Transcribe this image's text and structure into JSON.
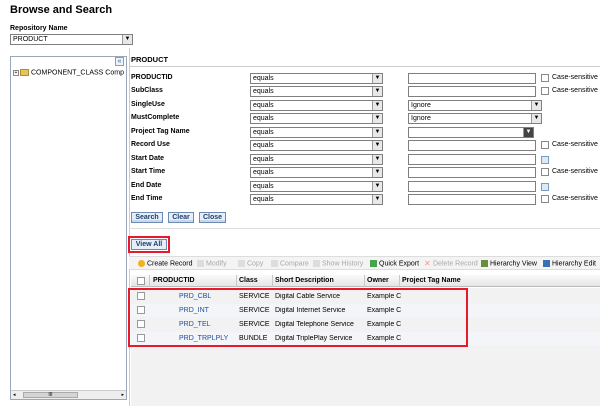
{
  "page": {
    "title": "Browse and Search"
  },
  "repository": {
    "label": "Repository Name",
    "value": "PRODUCT"
  },
  "tree": {
    "collapse_glyph": "«",
    "items": [
      "COMPONENT_CLASS Comp"
    ],
    "scroll_glyph": "III"
  },
  "search": {
    "section_title": "PRODUCT",
    "criteria": [
      {
        "label": "PRODUCTID",
        "operator": "equals",
        "value": "",
        "case_sensitive_label": "Case-sensitive",
        "has_case": true
      },
      {
        "label": "SubClass",
        "operator": "equals",
        "value": "",
        "case_sensitive_label": "Case-sensitive",
        "has_case": true
      },
      {
        "label": "SingleUse",
        "operator": "equals",
        "value": "Ignore",
        "has_case": false
      },
      {
        "label": "MustComplete",
        "operator": "equals",
        "value": "Ignore",
        "has_case": false
      },
      {
        "label": "Project Tag Name",
        "operator": "equals",
        "value": "",
        "has_case": false
      },
      {
        "label": "Record Use",
        "operator": "equals",
        "value": "",
        "case_sensitive_label": "Case-sensitive",
        "has_case": true
      },
      {
        "label": "Start Date",
        "operator": "equals",
        "value": "",
        "has_case": false
      },
      {
        "label": "Start Time",
        "operator": "equals",
        "value": "",
        "case_sensitive_label": "Case-sensitive",
        "has_case": true
      },
      {
        "label": "End Date",
        "operator": "equals",
        "value": "",
        "has_case": false
      },
      {
        "label": "End Time",
        "operator": "equals",
        "value": "",
        "case_sensitive_label": "Case-sensitive",
        "has_case": true
      }
    ],
    "buttons": {
      "search": "Search",
      "clear": "Clear",
      "close": "Close"
    },
    "view_all": "View All"
  },
  "toolbar": {
    "create": "Create Record",
    "modify": "Modify",
    "copy": "Copy",
    "compare": "Compare",
    "history": "Show History",
    "export": "Quick Export",
    "delete": "Delete Record",
    "hierarchy_view": "Hierarchy View",
    "hierarchy_edit": "Hierarchy Edit"
  },
  "grid": {
    "columns": [
      "PRODUCTID",
      "Class",
      "Short Description",
      "Owner",
      "Project Tag Name"
    ],
    "rows": [
      {
        "id": "PRD_CBL",
        "class": "SERVICE",
        "desc": "Digital Cable Service",
        "owner": "Example C"
      },
      {
        "id": "PRD_INT",
        "class": "SERVICE",
        "desc": "Digital Internet Service",
        "owner": "Example C"
      },
      {
        "id": "PRD_TEL",
        "class": "SERVICE",
        "desc": "Digital Telephone Service",
        "owner": "Example C"
      },
      {
        "id": "PRD_TRPLPLY",
        "class": "BUNDLE",
        "desc": "Digital TriplePlay Service",
        "owner": "Example C"
      }
    ]
  },
  "colors": {
    "highlight": "#e8192b",
    "link": "#1c4e9c",
    "button_bg": "#e6eef8"
  }
}
